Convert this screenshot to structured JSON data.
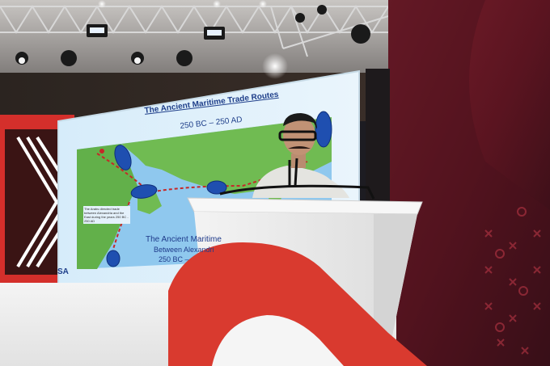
{
  "slide": {
    "title": "The Ancient Maritime Trade Routes",
    "subtitle": "250 BC – 250 AD",
    "overlay_title": "The Ancient Maritime",
    "overlay_line2": "Between Alexandri",
    "overlay_line3": "250 BC –",
    "note": "The Arabs directed trade between Alexandria and the East during the years 250 BC - 250 AD",
    "logo_text": "SA"
  },
  "colors": {
    "stage_floor": "#eeeeee",
    "brand_red": "#d42f2b",
    "screen_blue": "#9ccff0",
    "land_green": "#6ab84a",
    "backdrop_dark": "#2a1418"
  }
}
